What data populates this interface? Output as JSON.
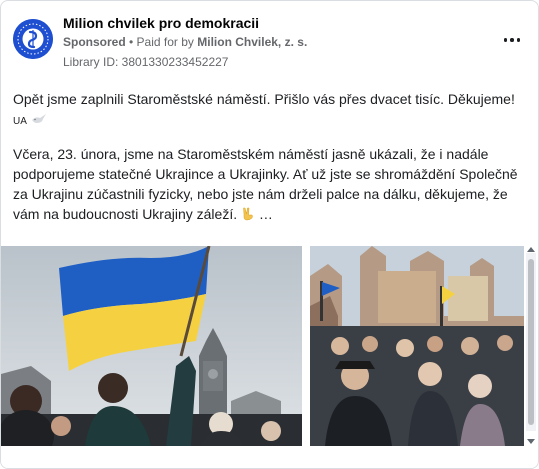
{
  "ad": {
    "page_name": "Milion chvilek pro demokracii",
    "sponsored_label": "Sponsored",
    "separator": " • ",
    "paid_for_prefix": "Paid for by ",
    "paid_for_entity": "Milion Chvilek, z. s.",
    "library_id": "Library ID: 3801330233452227",
    "more_icon": "more-horizontal-icon",
    "avatar_icon": "milion-chvilek-logo"
  },
  "body": {
    "paragraph1_text": "Opět jsme zaplnili Staroměstské náměstí. Přišlo vás přes dvacet tisíc. Děkujeme! ",
    "flag_label": "UA",
    "paragraph2_text": "Včera, 23. února, jsme na Staroměstském náměstí jasně ukázali, že i nadále podporujeme statečné Ukrajince a Ukrajinky. Ať už jste se shromáždění Společně za Ukrajinu zúčastnili fyzicky, nebo jste nám drželi palce na dálku, děkujeme, že vám na budoucnosti Ukrajiny záleží. ",
    "see_more": "…"
  },
  "carousel": {
    "images": [
      {
        "subject": "woman waving Ukrainian flag at rally on Old Town Square"
      },
      {
        "subject": "crowd at rally with historic buildings"
      }
    ],
    "next_icon": "chevron-right-icon"
  },
  "colors": {
    "flag_blue": "#1f5fc4",
    "flag_yellow": "#f5d142",
    "text_secondary": "#65676b"
  }
}
